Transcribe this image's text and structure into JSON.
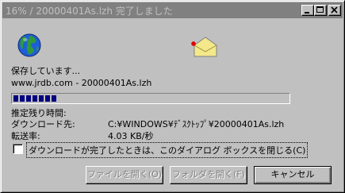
{
  "window": {
    "title": "16% / 20000401As.lzh 完了しました"
  },
  "status": {
    "saving": "保存しています...",
    "source": "www.jrdb.com - 20000401As.lzh",
    "progress_percent": 16
  },
  "details": {
    "remaining_label": "推定残り時間:",
    "remaining_value": "",
    "destination_label": "ダウンロード先:",
    "destination_value": "C:¥WINDOWS¥ﾃﾞｽｸﾄｯﾌﾟ¥20000401As.lzh",
    "rate_label": "転送率:",
    "rate_value": "4.03 KB/秒"
  },
  "options": {
    "close_on_complete_label": "ダウンロードが完了したときは、このダイアログ ボックスを閉じる(C)",
    "close_on_complete_checked": false
  },
  "buttons": {
    "open_file": "ファイルを開く(O)",
    "open_folder": "フォルダを開く(F)",
    "cancel": "キャンセル"
  },
  "icons": {
    "globe": "globe-icon",
    "folder": "folder-icon",
    "minimize": "minimize-icon",
    "maximize": "maximize-icon",
    "close": "close-icon"
  }
}
